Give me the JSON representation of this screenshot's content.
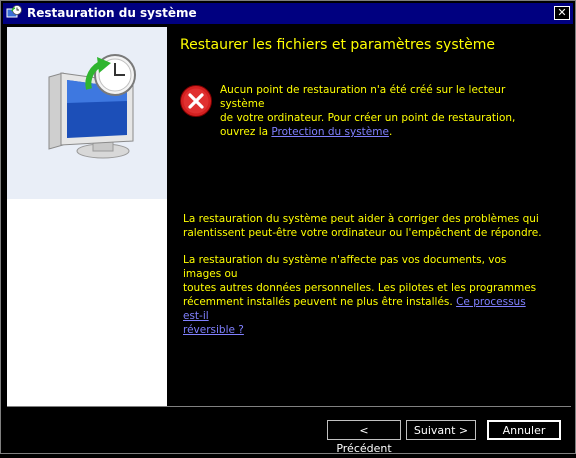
{
  "window": {
    "title": "Restauration du système",
    "close_label": "✕"
  },
  "header": {
    "heading": "Restaurer les fichiers et paramètres système"
  },
  "error": {
    "line1": "Aucun point de restauration n'a été créé sur le lecteur système",
    "line2": "de votre ordinateur. Pour créer un point de restauration,",
    "line3_prefix": "ouvrez la ",
    "link": "Protection du système",
    "line3_suffix": "."
  },
  "body": {
    "para1_line1": "La restauration du système peut aider à corriger des problèmes qui",
    "para1_line2": "ralentissent peut-être votre ordinateur ou l'empêchent de répondre.",
    "para2_line1": "La restauration du système n'affecte pas vos documents, vos images ou",
    "para2_line2": "toutes autres données personnelles. Les pilotes et les programmes",
    "para2_line3_prefix": "récemment installés peuvent ne plus être installés. ",
    "para2_link_part1": "Ce processus est-il",
    "para2_link_part2": "réversible ?"
  },
  "buttons": {
    "back": "< Précédent",
    "next": "Suivant >",
    "cancel": "Annuler"
  },
  "icons": {
    "title": "system-restore-icon",
    "art": "system-restore-monitor-icon",
    "error": "error-icon"
  },
  "colors": {
    "accent_text": "#ffff00",
    "link": "#8080ff",
    "titlebar": "#000080"
  }
}
